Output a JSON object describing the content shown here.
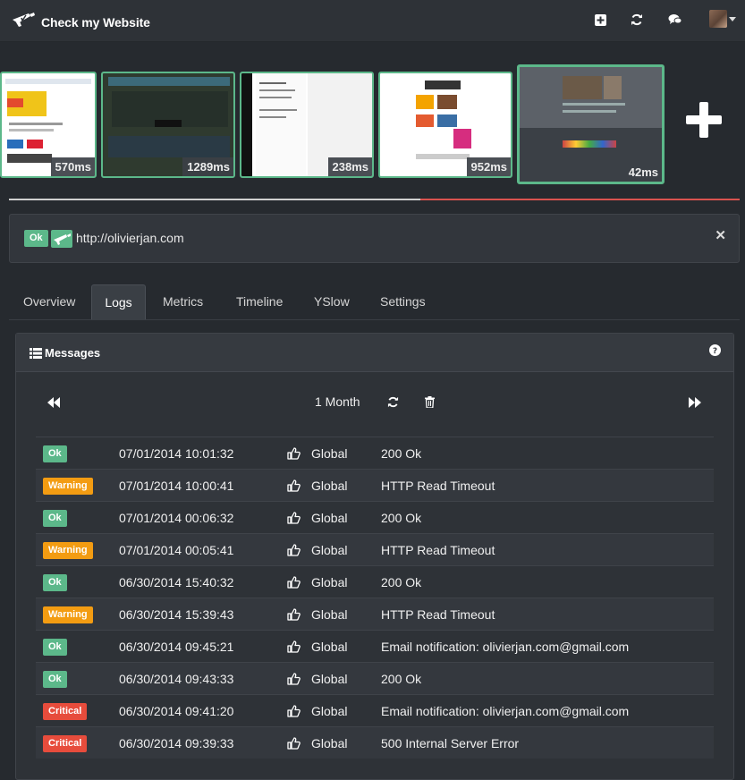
{
  "app": {
    "title": "Check my Website"
  },
  "nav": {
    "icons": [
      "plus-square-icon",
      "refresh-icon",
      "comments-icon",
      "user-avatar",
      "caret-down-icon"
    ]
  },
  "thumbnails": [
    {
      "ms": "570ms"
    },
    {
      "ms": "1289ms"
    },
    {
      "ms": "238ms"
    },
    {
      "ms": "952ms"
    },
    {
      "ms": "42ms",
      "selected": true
    }
  ],
  "site": {
    "status": "Ok",
    "url": "http://olivierjan.com"
  },
  "tabs": [
    {
      "label": "Overview"
    },
    {
      "label": "Logs",
      "active": true
    },
    {
      "label": "Metrics"
    },
    {
      "label": "Timeline"
    },
    {
      "label": "YSlow"
    },
    {
      "label": "Settings"
    }
  ],
  "messages": {
    "title": "Messages",
    "period": "1 Month",
    "rows": [
      {
        "status": "Ok",
        "date": "07/01/2014 10:01:32",
        "scope": "Global",
        "message": "200 Ok"
      },
      {
        "status": "Warning",
        "date": "07/01/2014 10:00:41",
        "scope": "Global",
        "message": "HTTP Read Timeout"
      },
      {
        "status": "Ok",
        "date": "07/01/2014 00:06:32",
        "scope": "Global",
        "message": "200 Ok"
      },
      {
        "status": "Warning",
        "date": "07/01/2014 00:05:41",
        "scope": "Global",
        "message": "HTTP Read Timeout"
      },
      {
        "status": "Ok",
        "date": "06/30/2014 15:40:32",
        "scope": "Global",
        "message": "200 Ok"
      },
      {
        "status": "Warning",
        "date": "06/30/2014 15:39:43",
        "scope": "Global",
        "message": "HTTP Read Timeout"
      },
      {
        "status": "Ok",
        "date": "06/30/2014 09:45:21",
        "scope": "Global",
        "message": "Email notification: olivierjan.com@gmail.com"
      },
      {
        "status": "Ok",
        "date": "06/30/2014 09:43:33",
        "scope": "Global",
        "message": "200 Ok"
      },
      {
        "status": "Critical",
        "date": "06/30/2014 09:41:20",
        "scope": "Global",
        "message": "Email notification: olivierjan.com@gmail.com"
      },
      {
        "status": "Critical",
        "date": "06/30/2014 09:39:33",
        "scope": "Global",
        "message": "500 Internal Server Error"
      }
    ]
  },
  "colors": {
    "ok": "#5cb88a",
    "warning": "#f39c12",
    "critical": "#e74c3c",
    "background": "#262a2f"
  }
}
